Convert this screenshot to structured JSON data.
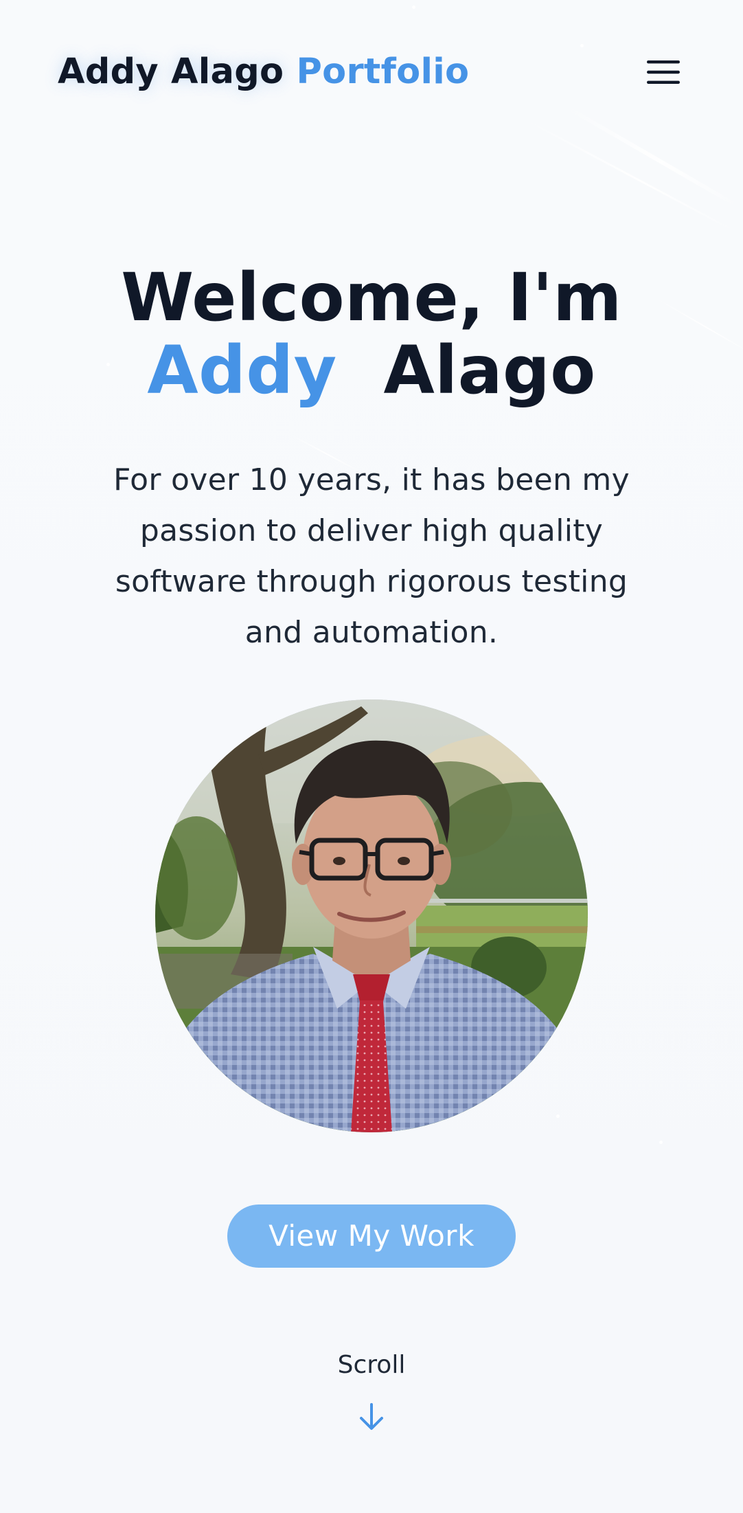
{
  "header": {
    "brand_name": "Addy Alago",
    "brand_accent": "Portfolio",
    "menu_icon": "hamburger-menu-icon"
  },
  "hero": {
    "title_line1": "Welcome, I'm",
    "title_first_name": "Addy",
    "title_last_name": "Alago",
    "description": "For over 10 years, it has been my passion to deliver high quality software through rigorous testing and automation.",
    "portrait_icon": "profile-photo"
  },
  "cta": {
    "label": "View My Work"
  },
  "scroll": {
    "label": "Scroll",
    "icon": "arrow-down-icon"
  },
  "colors": {
    "accent": "#4693e6",
    "cta_background": "#7ab7f2",
    "text_dark": "#101828",
    "background": "#f7f9fc"
  }
}
